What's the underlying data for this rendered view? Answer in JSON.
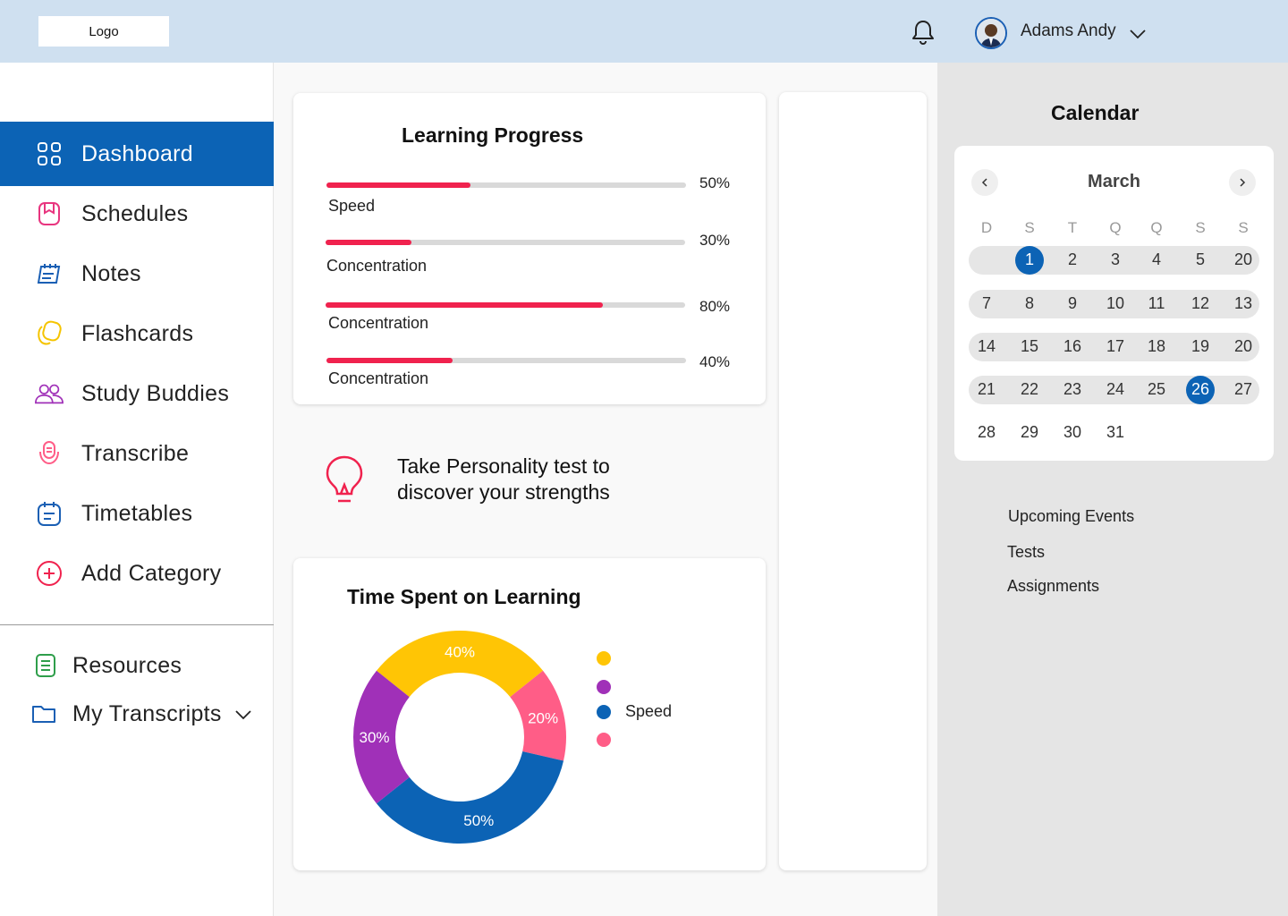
{
  "header": {
    "logo": "Logo",
    "user_name": "Adams Andy",
    "icons": {
      "notifications": "bell-icon",
      "user_menu": "chevron-down-icon"
    }
  },
  "sidebar": {
    "items": [
      {
        "label": "Dashboard",
        "icon": "dashboard-grid-icon",
        "active": true
      },
      {
        "label": "Schedules",
        "icon": "bookmark-icon"
      },
      {
        "label": "Notes",
        "icon": "notebook-icon"
      },
      {
        "label": "Flashcards",
        "icon": "flashcards-icon"
      },
      {
        "label": "Study Buddies",
        "icon": "users-icon"
      },
      {
        "label": "Transcribe",
        "icon": "transcribe-icon"
      },
      {
        "label": "Timetables",
        "icon": "timetable-icon"
      },
      {
        "label": "Add Category",
        "icon": "add-circle-icon"
      }
    ],
    "bottom_items": [
      {
        "label": "Resources",
        "icon": "document-icon"
      },
      {
        "label": "My Transcripts",
        "icon": "folder-icon"
      }
    ]
  },
  "learning_progress": {
    "title": "Learning Progress",
    "items": [
      {
        "label": "Speed",
        "pct_label": "50%",
        "value": 0.4
      },
      {
        "label": "Concentration",
        "pct_label": "30%",
        "value": 0.24
      },
      {
        "label": "Concentration",
        "pct_label": "80%",
        "value": 0.77
      },
      {
        "label": "Concentration",
        "pct_label": "40%",
        "value": 0.35
      }
    ]
  },
  "personality": {
    "icon": "lightbulb-icon",
    "line1": "Take Personality test to",
    "line2": "discover your strengths"
  },
  "time_spent": {
    "title": "Time Spent on Learning",
    "chart_data": {
      "type": "pie",
      "donut": true,
      "title": "Time Spent on Learning",
      "slices": [
        {
          "label": "40%",
          "value": 40,
          "color": "#ffc505"
        },
        {
          "label": "20%",
          "value": 20,
          "color": "#ff5d87"
        },
        {
          "label": "50%",
          "value": 50,
          "color": "#0c63b5"
        },
        {
          "label": "30%",
          "value": 30,
          "color": "#a030b8"
        }
      ],
      "legend": [
        {
          "name": "",
          "color": "#ffc505"
        },
        {
          "name": "",
          "color": "#a030b8"
        },
        {
          "name": "Speed",
          "color": "#0c63b5"
        },
        {
          "name": "",
          "color": "#ff5d87"
        }
      ],
      "legend_placement": "right"
    }
  },
  "calendar": {
    "heading": "Calendar",
    "month": "March",
    "weekdays": [
      "D",
      "S",
      "T",
      "Q",
      "Q",
      "S",
      "S"
    ],
    "weeks": [
      [
        "",
        "1",
        "2",
        "3",
        "4",
        "5",
        "20"
      ],
      [
        "7",
        "8",
        "9",
        "10",
        "11",
        "12",
        "13"
      ],
      [
        "14",
        "15",
        "16",
        "17",
        "18",
        "19",
        "20"
      ],
      [
        "21",
        "22",
        "23",
        "24",
        "25",
        "26",
        "27"
      ],
      [
        "28",
        "29",
        "30",
        "31",
        "",
        "",
        ""
      ]
    ],
    "selected": [
      "1",
      "26"
    ],
    "highlighted_weeks": [
      0,
      1,
      2,
      3
    ]
  },
  "events": {
    "upcoming": "Upcoming Events",
    "tests": "Tests",
    "assignments": "Assignments"
  },
  "colors": {
    "primary": "#0c63b5",
    "progress": "#f0224e",
    "header_bg": "#cfe0f0"
  }
}
